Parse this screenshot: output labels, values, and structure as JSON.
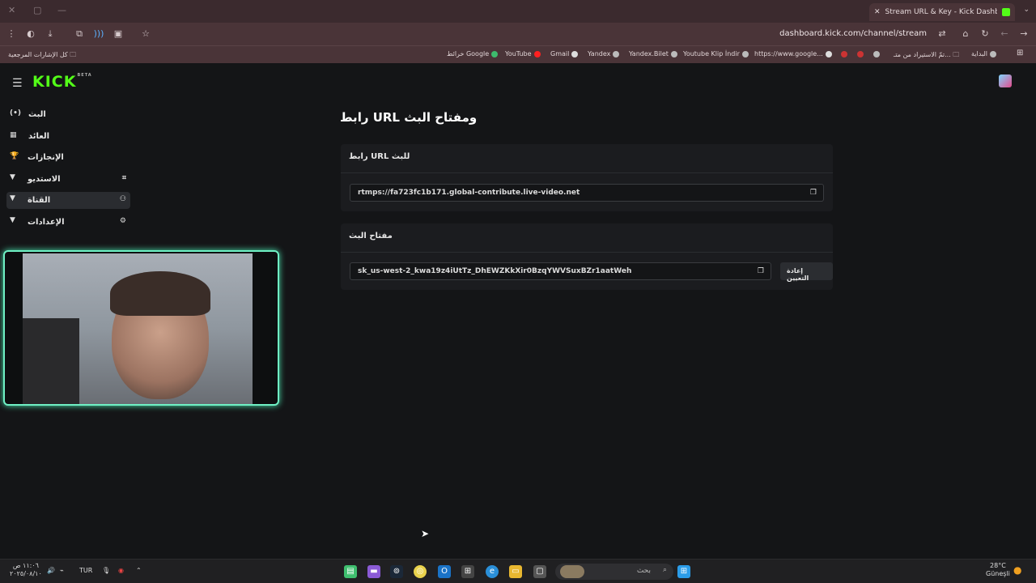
{
  "browser": {
    "tab_title": "Stream URL & Key - Kick Dashb",
    "kick_favicon": "K",
    "new_tab": "+",
    "url": "dashboard.kick.com/channel/stream",
    "bookmarks": [
      {
        "label": "البداية",
        "color": "#bbbbbb"
      },
      {
        "label": "تمّ الاستيراد من متـ...",
        "color": "#c8a060"
      },
      {
        "label": "",
        "color": "#bbbbbb"
      },
      {
        "label": "",
        "color": "#cc3333"
      },
      {
        "label": "",
        "color": "#cc3333"
      },
      {
        "label": "https://www.google...",
        "color": "#dddddd"
      },
      {
        "label": "Youtube Klip İndir",
        "color": "#bbbbbb"
      },
      {
        "label": "Yandex.Bilet",
        "color": "#bbbbbb"
      },
      {
        "label": "Yandex",
        "color": "#bbbbbb"
      },
      {
        "label": "Gmail",
        "color": "#dddddd"
      },
      {
        "label": "YouTube",
        "color": "#ff2020"
      },
      {
        "label": "خرائط Google",
        "color": "#3dbb6d"
      }
    ],
    "all_bookmarks": "كل الإشارات المرجعية"
  },
  "app": {
    "logo": "KICK",
    "logo_badge": "BETA"
  },
  "sidebar": {
    "items": [
      {
        "label": "البث",
        "icon": "(•)",
        "chevron": false
      },
      {
        "label": "العائد",
        "icon": "▦",
        "chevron": false
      },
      {
        "label": "الإنجازات",
        "icon": "🏆",
        "chevron": false
      },
      {
        "label": "الاستديو",
        "icon": "⌗",
        "chevron": true
      },
      {
        "label": "القناة",
        "icon": "⚇",
        "chevron": true
      },
      {
        "label": "الإعدادات",
        "icon": "⚙",
        "chevron": true
      }
    ]
  },
  "main": {
    "title": "رابط URL ومفتاح البث",
    "url_section": {
      "heading": "رابط URL للبث",
      "value": "rtmps://fa723fc1b171.global-contribute.live-video.net"
    },
    "key_section": {
      "heading": "مفتاح البث",
      "value": "sk_us-west-2_kwa19z4iUtTz_DhEWZKkXir0BzqYWVSuxBZr1aatWeh",
      "reset_label": "إعادة التعيين"
    }
  },
  "taskbar": {
    "search_placeholder": "بحث",
    "weather_temp": "28°C",
    "weather_desc": "Güneşli",
    "lang": "TUR",
    "time": "١١:٠٦ ص",
    "date": "٢٠٢٥/٠٨/١٠"
  },
  "colors": {
    "kick_green": "#53fc18",
    "webcam_border": "#6ff0c4",
    "browser_chrome": "#4a3438"
  }
}
